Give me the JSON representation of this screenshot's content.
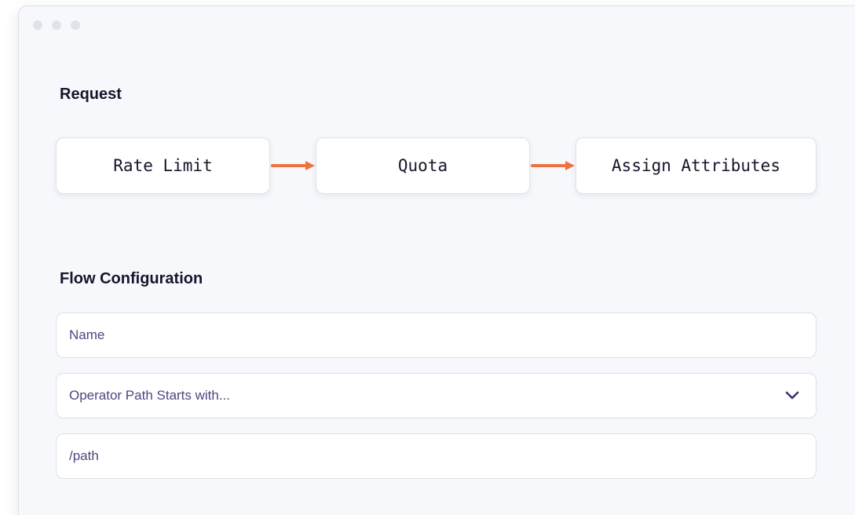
{
  "request": {
    "title": "Request",
    "steps": [
      {
        "label": "Rate Limit"
      },
      {
        "label": "Quota"
      },
      {
        "label": "Assign Attributes"
      }
    ]
  },
  "flow_configuration": {
    "title": "Flow Configuration",
    "name_field": {
      "value": "Name"
    },
    "operator_select": {
      "value": "Operator Path Starts with..."
    },
    "path_field": {
      "value": "/path"
    }
  },
  "colors": {
    "arrow": "#f0713f",
    "text_dark": "#14162b",
    "field_text": "#4f4680",
    "window_bg": "#f7f8fc"
  },
  "icons": {
    "window_dots": "window-control-dots",
    "step_arrow": "arrow-right-icon",
    "dropdown": "chevron-down-icon"
  }
}
